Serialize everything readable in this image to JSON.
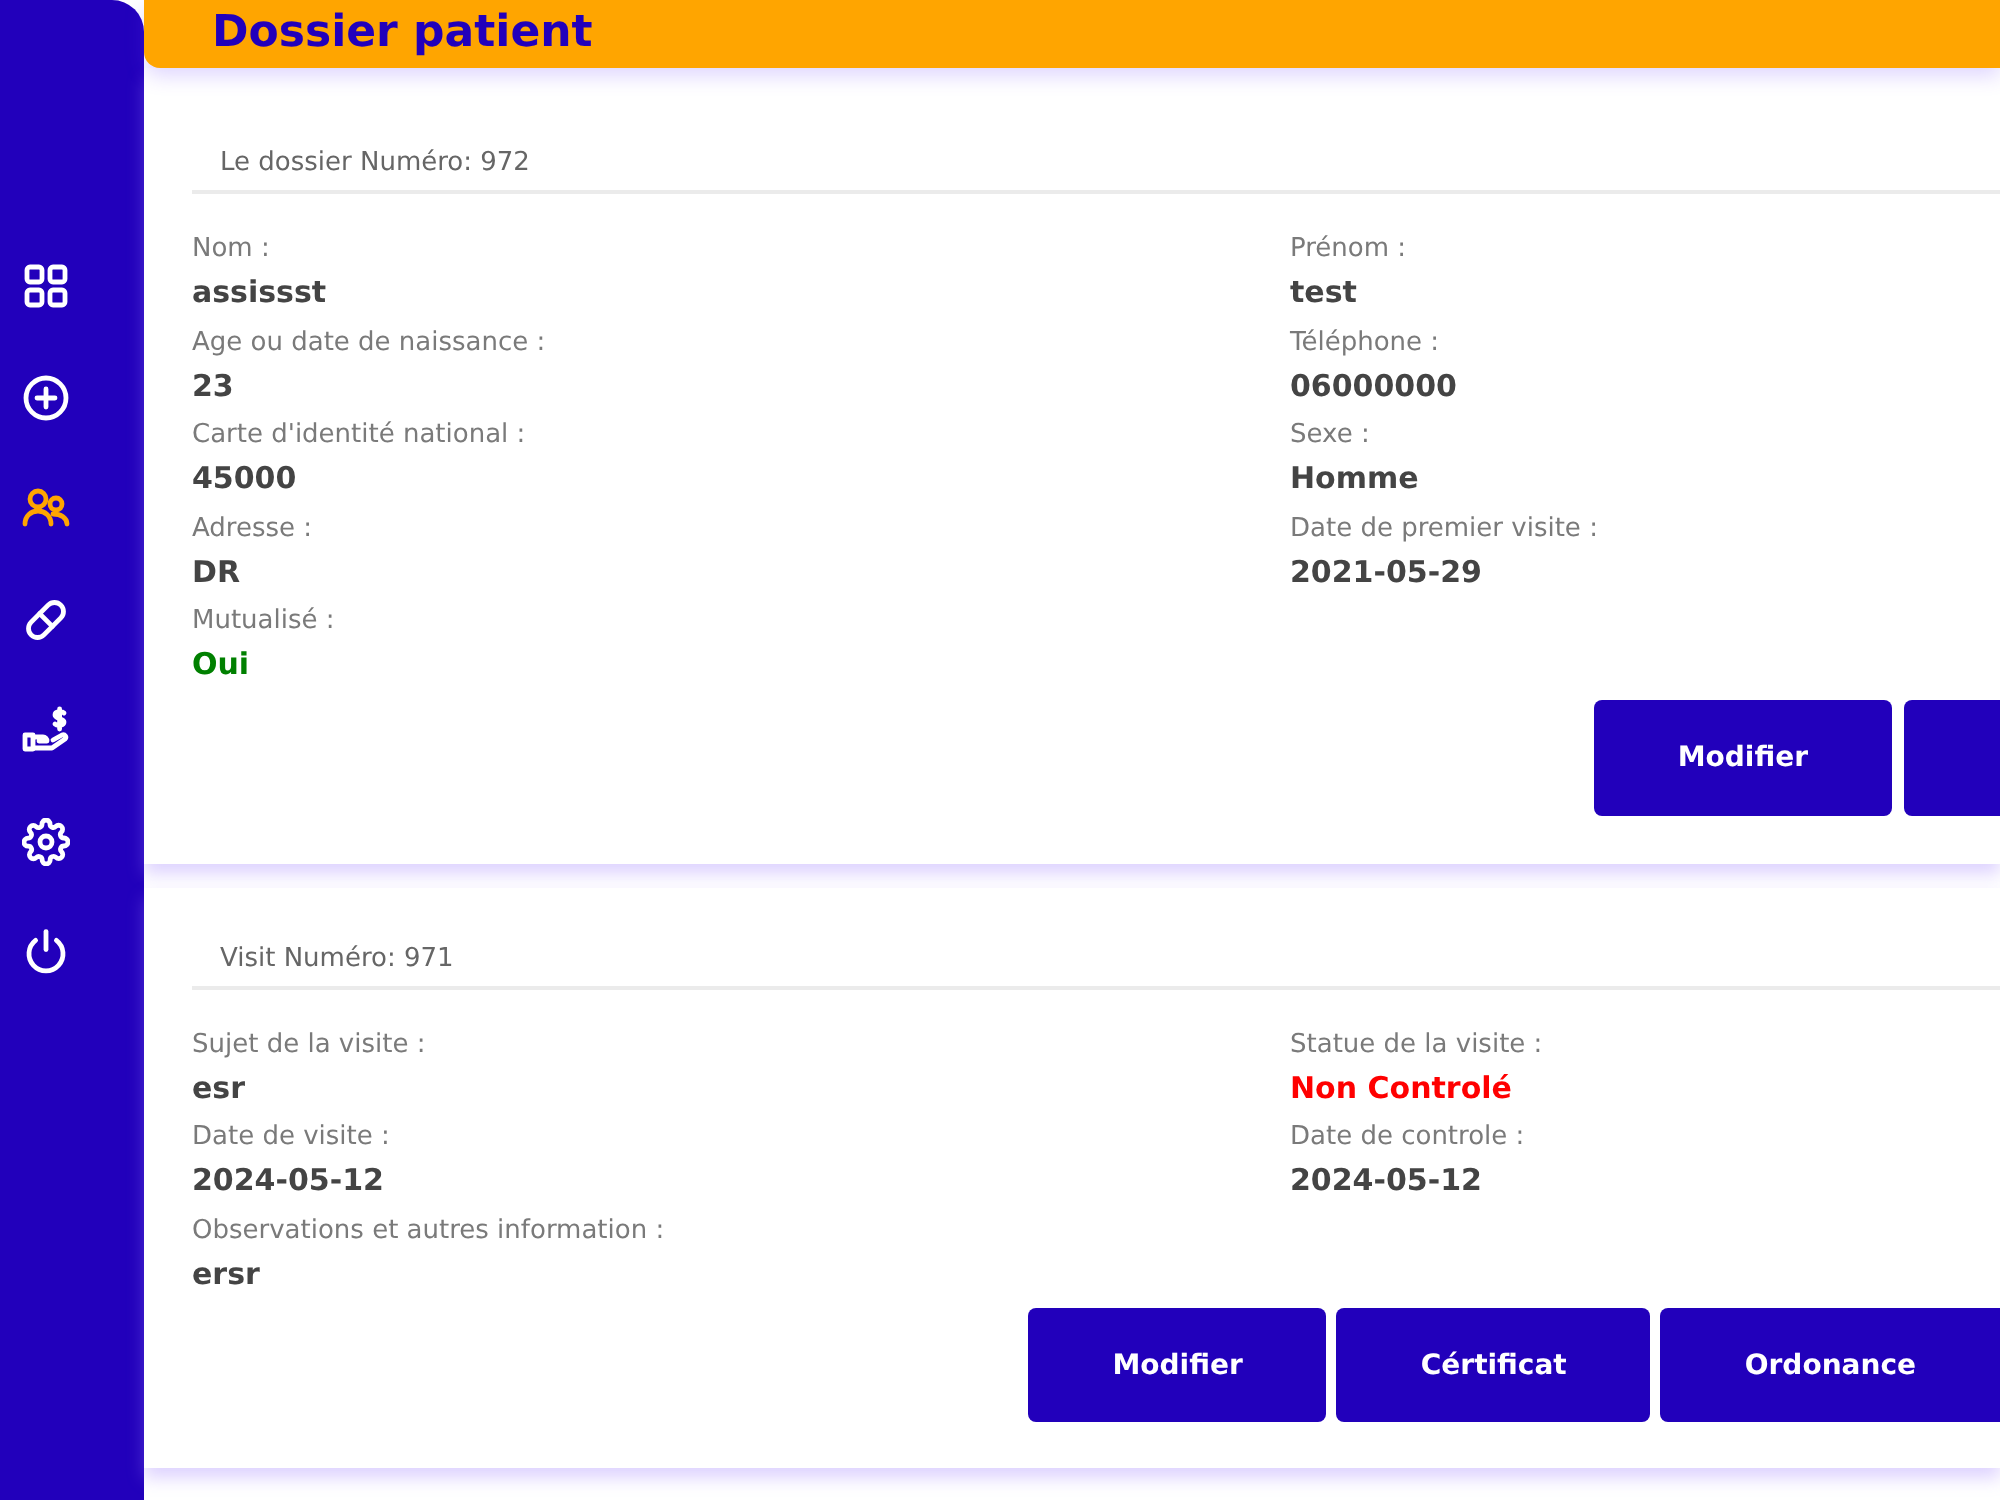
{
  "sidebar": {
    "items": [
      {
        "selected": false
      },
      {
        "selected": false
      },
      {
        "selected": true
      },
      {
        "selected": false
      },
      {
        "selected": false
      },
      {
        "selected": false
      },
      {
        "selected": false
      }
    ]
  },
  "header": {
    "title": "Dossier patient"
  },
  "cards": [
    {
      "heading": "Le dossier Numéro: 972",
      "left_fields": [
        {
          "label": "Nom :",
          "value": "assissst"
        },
        {
          "label": "Age ou date de naissance :",
          "value": "23"
        },
        {
          "label": "Carte d'identité national :",
          "value": "45000"
        },
        {
          "label": "Adresse :",
          "value": "DR"
        },
        {
          "label": "Mutualisé :",
          "value": "Oui",
          "color": "#008000"
        }
      ],
      "right_fields": [
        {
          "label": "Prénom :",
          "value": "test"
        },
        {
          "label": "Téléphone :",
          "value": "06000000"
        },
        {
          "label": "Sexe :",
          "value": "Homme"
        },
        {
          "label": "Date de premier visite :",
          "value": "2021-05-29"
        }
      ],
      "buttons": [
        {
          "kind": "full",
          "label": "Modifier"
        },
        {
          "kind": "edge"
        }
      ]
    },
    {
      "heading": "Visit Numéro: 971",
      "left_fields": [
        {
          "label": "Sujet de la visite :",
          "value": "esr"
        },
        {
          "label": "Date de visite :",
          "value": "2024-05-12"
        },
        {
          "label": "Observations et autres information :",
          "value": "ersr"
        }
      ],
      "right_fields": [
        {
          "label": "Statue de la visite :",
          "value": "Non Controlé",
          "color": "#ff0000"
        },
        {
          "label": "Date de controle :",
          "value": "2024-05-12"
        }
      ],
      "buttons": [
        {
          "kind": "full",
          "label": "Modifier"
        },
        {
          "kind": "full",
          "label": "Cértificat"
        },
        {
          "kind": "edge",
          "label": "Ordonance"
        }
      ]
    }
  ]
}
